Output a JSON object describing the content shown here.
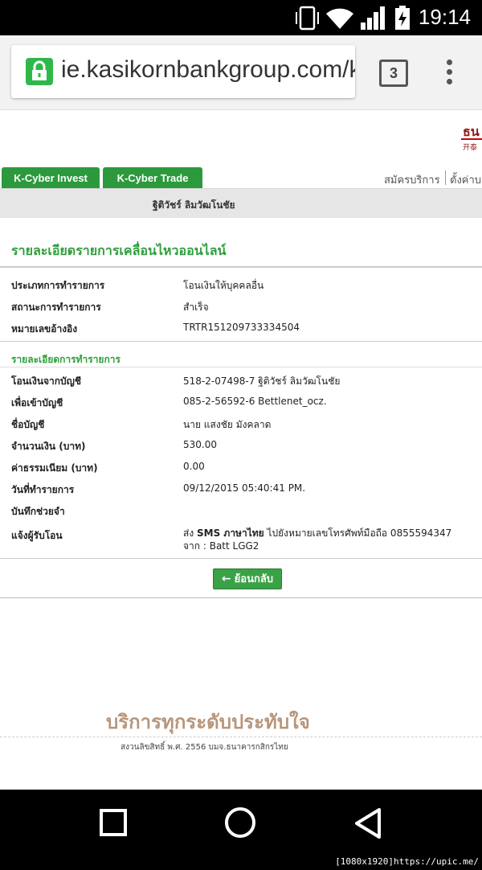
{
  "status_bar": {
    "time": "19:14"
  },
  "browser": {
    "url": "ie.kasikornbankgroup.com/k",
    "tab_count": "3"
  },
  "page": {
    "logo_partial": "ธน",
    "logo_sub": "开泰",
    "tabs": [
      "K-Cyber Invest",
      "K-Cyber Trade"
    ],
    "top_links": [
      "สมัครบริการ",
      "ตั้งค่าบ"
    ],
    "user_name": "ฐิติวัชร์ ลิมวัฒโนชัย",
    "title": "รายละเอียดรายการเคลื่อนไหวออนไลน์",
    "summary": [
      {
        "label": "ประเภทการทำรายการ",
        "value": "โอนเงินให้บุคคลอื่น"
      },
      {
        "label": "สถานะการทำรายการ",
        "value": "สำเร็จ"
      },
      {
        "label": "หมายเลขอ้างอิง",
        "value": "TRTR151209733334504"
      }
    ],
    "detail_section_title": "รายละเอียดการทำรายการ",
    "details": [
      {
        "label": "โอนเงินจากบัญชี",
        "value": "518-2-07498-7 ฐิติวัชร์ ลิมวัฒโนชัย"
      },
      {
        "label": "เพื่อเข้าบัญชี",
        "value": "085-2-56592-6 Bettlenet_ocz."
      },
      {
        "label": "ชื่อบัญชี",
        "value": "นาย แสงชัย มังคลาด"
      },
      {
        "label": "จำนวนเงิน (บาท)",
        "value": "530.00"
      },
      {
        "label": "ค่าธรรมเนียม (บาท)",
        "value": "0.00"
      },
      {
        "label": "วันที่ทำรายการ",
        "value": "09/12/2015 05:40:41 PM."
      },
      {
        "label": "บันทึกช่วยจำ",
        "value": ""
      }
    ],
    "notify": {
      "label": "แจ้งผู้รับโอน",
      "prefix": "ส่ง ",
      "bold": "SMS ภาษาไทย",
      "suffix": " ไปยังหมายเลขโทรศัพท์มือถือ 0855594347",
      "line2": "จาก : Batt LGG2"
    },
    "back_button": "ย้อนกลับ",
    "slogan": "บริการทุกระดับประทับใจ",
    "copyright": "สงวนลิขสิทธิ์ พ.ศ. 2556 บมจ.ธนาคารกสิกรไทย"
  },
  "watermark": "[1080x1920]https://upic.me/",
  "colors": {
    "accent_green": "#2f9e3c",
    "tab_green": "#2c9a3c",
    "lock_green": "#2eb84a"
  }
}
